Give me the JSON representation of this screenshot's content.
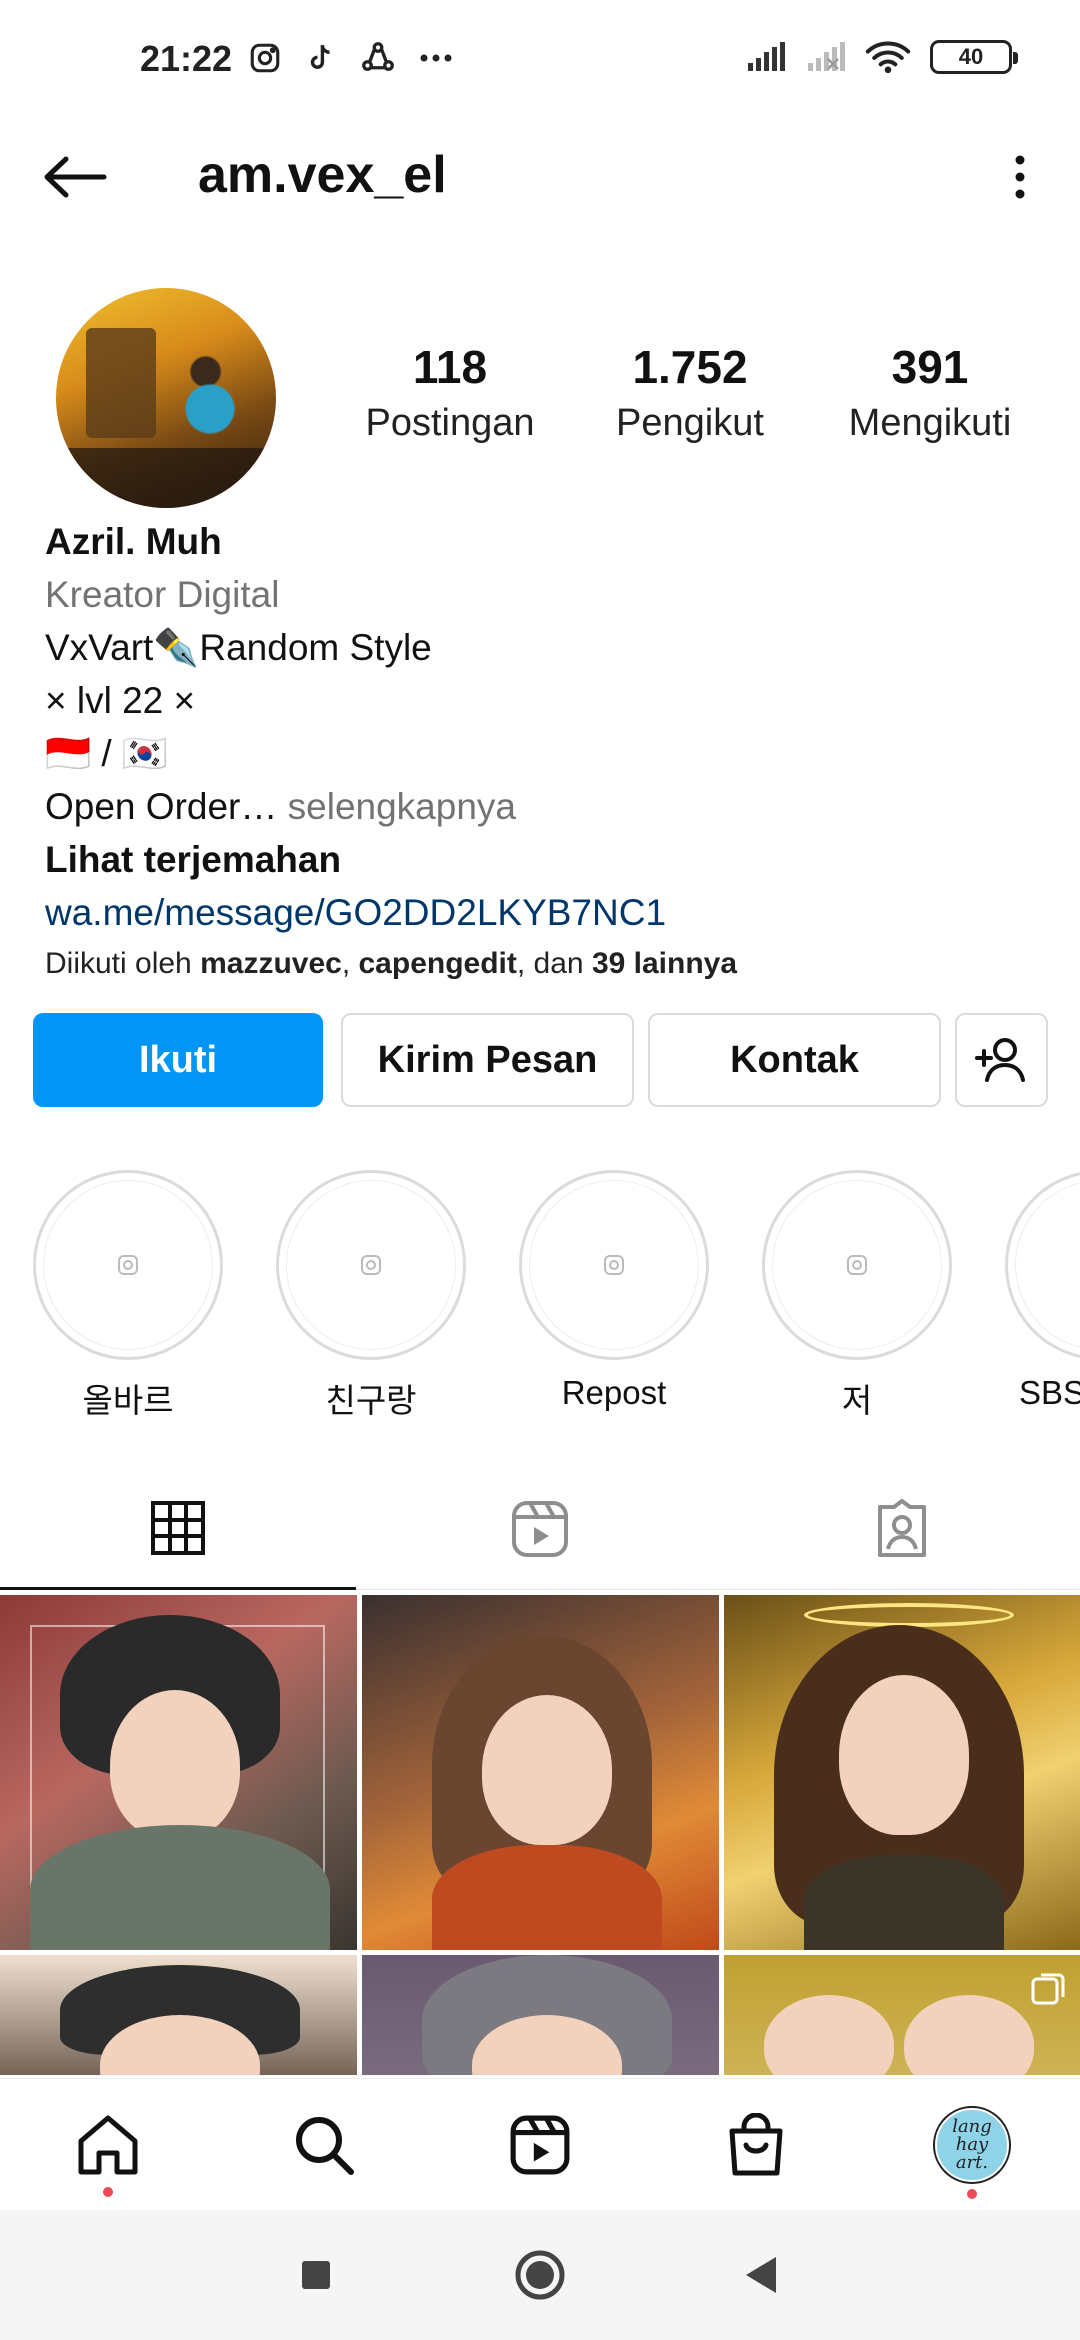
{
  "status_bar": {
    "time": "21:22",
    "left_icons": [
      "instagram-icon",
      "tiktok-icon",
      "sync-icon",
      "more-dots-icon"
    ],
    "right_icons": [
      "signal-icon",
      "signal-weak-icon",
      "wifi-icon"
    ],
    "battery": "40"
  },
  "header": {
    "username": "am.vex_el"
  },
  "profile": {
    "stats": [
      {
        "value": "118",
        "label": "Postingan"
      },
      {
        "value": "1.752",
        "label": "Pengikut"
      },
      {
        "value": "391",
        "label": "Mengikuti"
      }
    ],
    "name": "Azril. Muh",
    "category": "Kreator Digital",
    "bio_lines": [
      "VxVart✒️Random Style",
      "× lvl 22 ×",
      "🇮🇩 / 🇰🇷"
    ],
    "bio_open_order": "Open Order…",
    "bio_more": "selengkapnya",
    "translate": "Lihat terjemahan",
    "link": "wa.me/message/GO2DD2LKYB7NC1",
    "followed_by": {
      "prefix": "Diikuti oleh ",
      "user1": "mazzuvec",
      "sep": ", ",
      "user2": "capengedit",
      "mid": ", dan ",
      "others": "39 lainnya"
    }
  },
  "actions": {
    "follow": "Ikuti",
    "message": "Kirim Pesan",
    "contact": "Kontak"
  },
  "highlights": [
    {
      "label": "올바르"
    },
    {
      "label": "친구랑"
    },
    {
      "label": "Repost"
    },
    {
      "label": "저"
    },
    {
      "label": "SBS"
    }
  ],
  "tabs": [
    "grid-icon",
    "reels-icon",
    "tagged-icon"
  ],
  "bottom_nav": [
    "home-icon",
    "search-icon",
    "reels-icon",
    "shop-icon",
    "profile-avatar"
  ],
  "nav_avatar_text": "lang\nhay\nart."
}
